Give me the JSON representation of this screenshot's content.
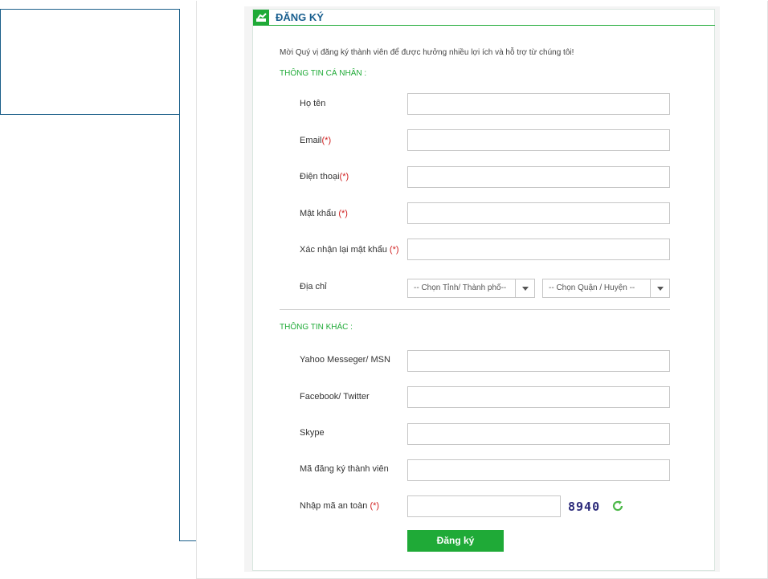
{
  "form": {
    "title": "ĐĂNG KÝ",
    "intro": "Mời Quý vị đăng ký thành viên để được hưởng nhiều lợi ích và hỗ trợ từ chúng tôi!",
    "required_mark": "(*)",
    "personal_section": "THÔNG TIN CÁ NHÂN :",
    "other_section": "THÔNG TIN KHÁC :",
    "fields": {
      "fullname": {
        "label": "Họ tên",
        "value": ""
      },
      "email": {
        "label": "Email",
        "value": ""
      },
      "phone": {
        "label": "Điện thoại",
        "value": ""
      },
      "password": {
        "label": "Mật khẩu",
        "value": ""
      },
      "confirm_password": {
        "label": "Xác nhận lại mật khẩu",
        "value": ""
      },
      "address": {
        "label": "Địa chỉ"
      },
      "yahoo": {
        "label": "Yahoo Messeger/ MSN",
        "value": ""
      },
      "social": {
        "label": "Facebook/ Twitter",
        "value": ""
      },
      "skype": {
        "label": "Skype",
        "value": ""
      },
      "member_code": {
        "label": "Mã đăng ký thành viên",
        "value": ""
      },
      "captcha_input": {
        "label": "Nhập mã an toàn",
        "value": ""
      }
    },
    "province_select": "-- Chọn Tỉnh/ Thành phố--",
    "district_select": "-- Chọn Quận / Huyện --",
    "captcha_code": "8940",
    "submit_label": "Đăng ký"
  },
  "colors": {
    "accent": "#1faa37",
    "title": "#1a5f8f",
    "required": "#d01f1f",
    "annotation": "#1b5f8a"
  },
  "icons": {
    "header": "signup-icon",
    "refresh": "refresh-icon",
    "select_arrow": "chevron-down-icon"
  }
}
